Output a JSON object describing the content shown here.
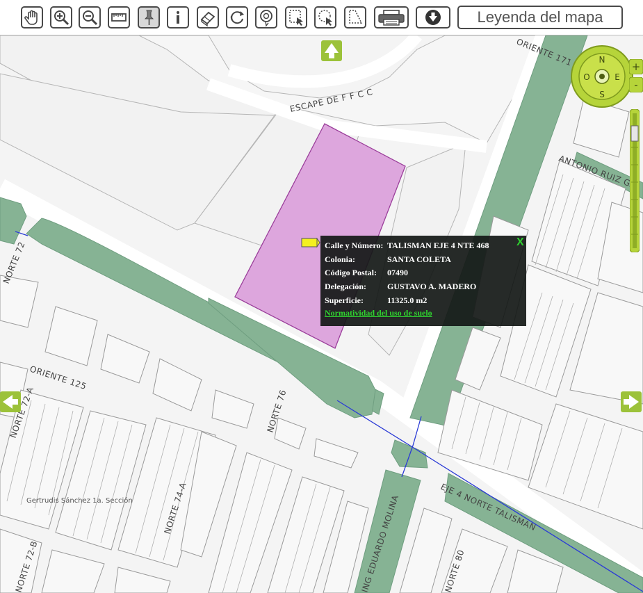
{
  "toolbar": {
    "tools": [
      {
        "id": "pan",
        "icon": "hand-icon"
      },
      {
        "id": "zoom-in",
        "icon": "zoom-in-icon"
      },
      {
        "id": "zoom-out",
        "icon": "zoom-out-icon"
      },
      {
        "id": "measure",
        "icon": "ruler-icon"
      },
      {
        "id": "identify-pin",
        "icon": "pushpin-icon",
        "active": true
      },
      {
        "id": "info",
        "icon": "info-icon"
      },
      {
        "id": "erase",
        "icon": "eraser-icon"
      },
      {
        "id": "refresh",
        "icon": "refresh-icon"
      },
      {
        "id": "lasso",
        "icon": "lasso-icon"
      },
      {
        "id": "select-rectangle",
        "icon": "rectangle-select-icon"
      },
      {
        "id": "select-circle",
        "icon": "circle-select-icon"
      },
      {
        "id": "select-polygon",
        "icon": "polygon-select-icon"
      },
      {
        "id": "print",
        "icon": "printer-icon"
      },
      {
        "id": "download",
        "icon": "download-icon"
      }
    ],
    "legend_label": "Leyenda del mapa"
  },
  "map": {
    "streets": {
      "escape": "ESCAPE DE F F C C",
      "oriente_171": "ORIENTE 171",
      "antonio_ruiz": "ANTONIO RUIZ GA",
      "norte_72": "NORTE 72",
      "oriente_125": "ORIENTE 125",
      "norte_72a": "NORTE 72-A",
      "norte_76": "NORTE 76",
      "norte_74a": "NORTE 74-A",
      "norte_72b": "NORTE 72-B",
      "eduardo_molina": "ING EDUARDO MOLINA",
      "norte_80": "NORTE 80",
      "talisman": "EJE 4 NORTE TALISMAN"
    },
    "neighborhood_label": "Gertrudis Sánchez 1a. Sección",
    "colors": {
      "background": "#f3f3f3",
      "block": "#f7f7f7",
      "block_outline": "#9a9a9a",
      "green_strip": "#86b394",
      "selected_parcel": "#dda6dd",
      "selected_parcel_outline": "#9b3f9b",
      "road_line": "#2b3bd6",
      "nav_green": "#9cc23a"
    }
  },
  "popup": {
    "fields": [
      {
        "label": "Calle y Número:",
        "value": "TALISMAN EJE 4 NTE 468"
      },
      {
        "label": "Colonia:",
        "value": "SANTA COLETA"
      },
      {
        "label": "Código Postal:",
        "value": "07490"
      },
      {
        "label": "Delegación:",
        "value": "GUSTAVO A. MADERO"
      },
      {
        "label": "Superficie:",
        "value": "11325.0 m2"
      }
    ],
    "link": "Normatividad del uso de suelo",
    "close": "X"
  },
  "compass": {
    "n": "N",
    "s": "S",
    "e": "E",
    "w": "O"
  },
  "zoom": {
    "plus": "+",
    "minus": "-"
  }
}
